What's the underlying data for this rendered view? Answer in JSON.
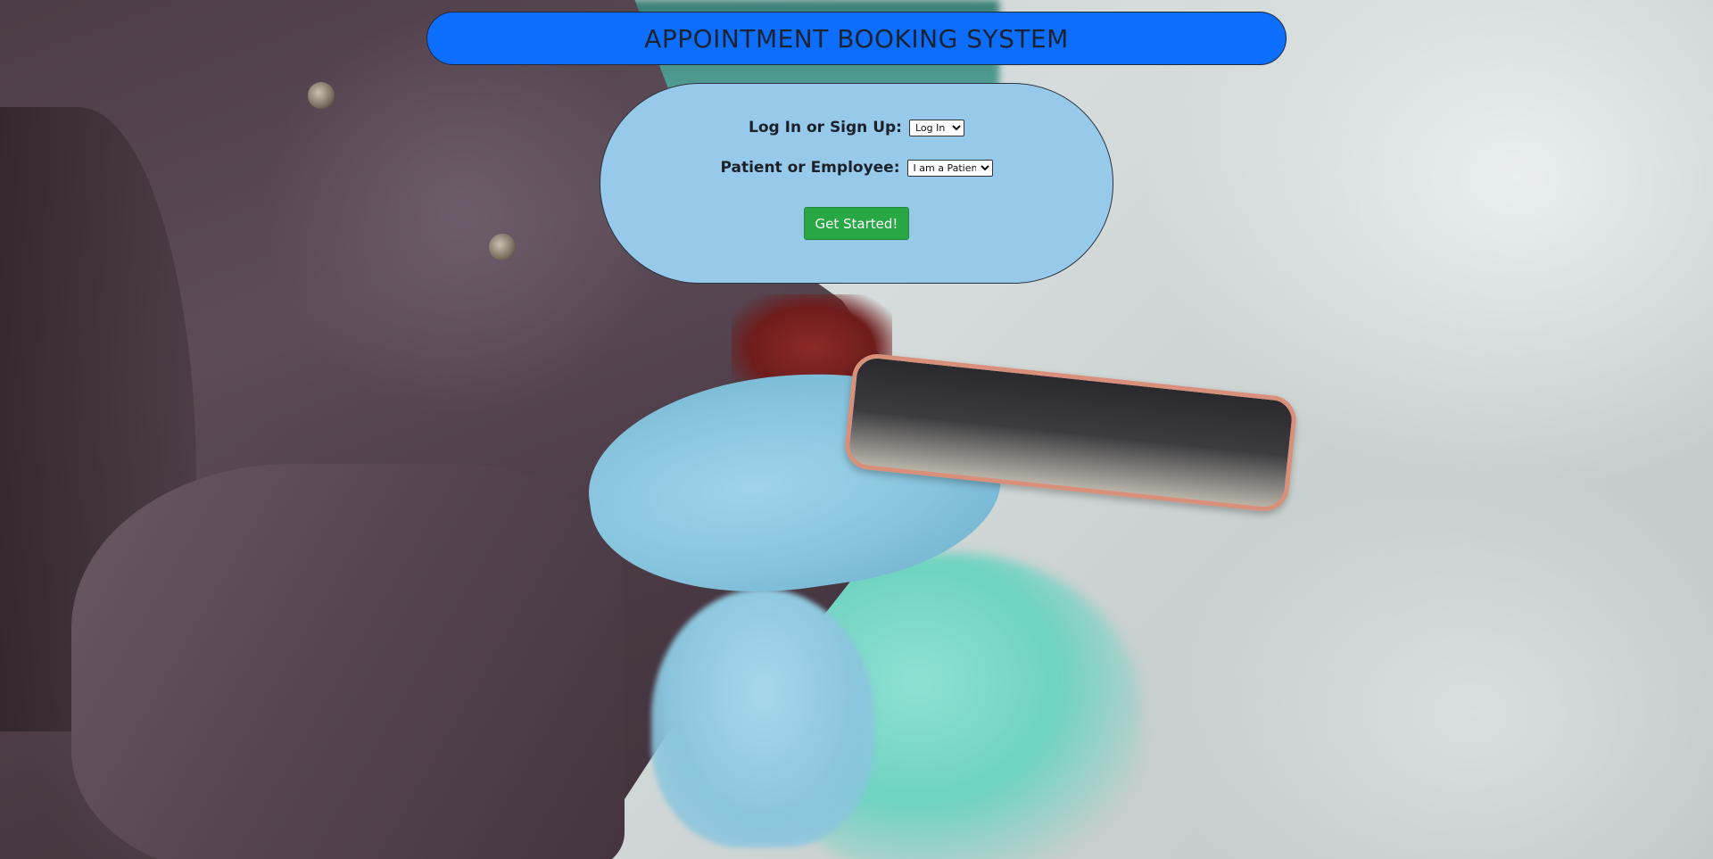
{
  "header": {
    "title": "APPOINTMENT BOOKING SYSTEM"
  },
  "form": {
    "auth_mode": {
      "label": "Log In or Sign Up:",
      "selected": "Log In"
    },
    "user_type": {
      "label": "Patient or Employee:",
      "selected": "I am a Patient"
    },
    "submit_label": "Get Started!"
  },
  "colors": {
    "header_bg": "#0d6efd",
    "card_bg": "#96c9ea",
    "button_bg": "#28a745"
  }
}
